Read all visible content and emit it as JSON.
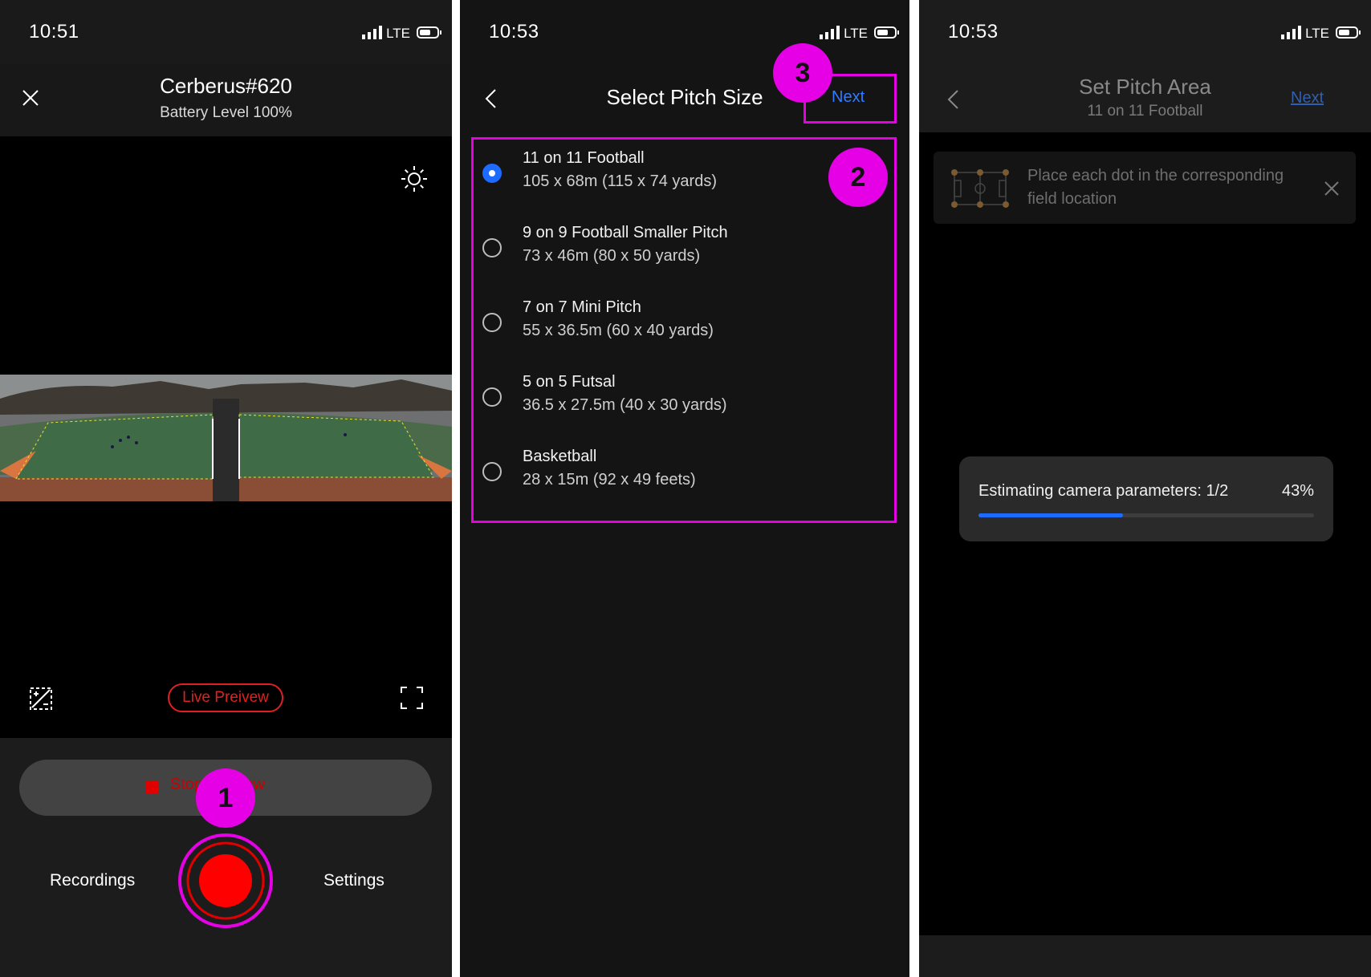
{
  "screen1": {
    "status": {
      "time": "10:51",
      "network": "LTE"
    },
    "header": {
      "title": "Cerberus#620",
      "subtitle": "Battery Level 100%"
    },
    "live_badge": "Live Preivew",
    "stop_button": "Stop Preview",
    "nav": {
      "recordings": "Recordings",
      "settings": "Settings"
    },
    "callout": "1"
  },
  "screen2": {
    "status": {
      "time": "10:53",
      "network": "LTE"
    },
    "title": "Select Pitch Size",
    "next": "Next",
    "options": [
      {
        "name": "11 on 11 Football",
        "dims": "105 x 68m (115 x 74 yards)",
        "selected": true
      },
      {
        "name": "9 on 9 Football Smaller Pitch",
        "dims": "73 x 46m (80 x 50 yards)",
        "selected": false
      },
      {
        "name": "7 on 7 Mini Pitch",
        "dims": "55 x 36.5m (60 x 40 yards)",
        "selected": false
      },
      {
        "name": "5 on 5 Futsal",
        "dims": "36.5 x 27.5m (40 x 30 yards)",
        "selected": false
      },
      {
        "name": "Basketball",
        "dims": "28 x 15m (92 x 49 feets)",
        "selected": false
      }
    ],
    "callouts": {
      "list": "2",
      "next": "3"
    }
  },
  "screen3": {
    "status": {
      "time": "10:53",
      "network": "LTE"
    },
    "title": "Set Pitch Area",
    "subtitle": "11 on 11 Football",
    "next": "Next",
    "hint": "Place each dot in the corresponding field location",
    "progress": {
      "label": "Estimating camera parameters: 1/2",
      "percent_text": "43%",
      "value": 0.43
    }
  },
  "colors": {
    "accent_blue": "#1e6bff",
    "record_red": "#e00000",
    "callout_magenta": "#e600e6"
  }
}
